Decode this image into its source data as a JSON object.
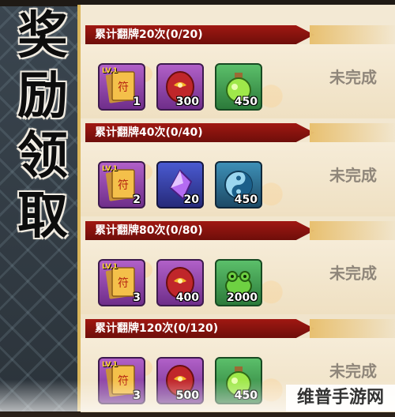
{
  "title_chars": [
    "奖",
    "励",
    "领",
    "取"
  ],
  "rows": [
    {
      "label": "累计翻牌20次(0/20)",
      "status": "未完成",
      "items": [
        {
          "icon": "scroll-card-icon",
          "lv": "LV.1",
          "count": "1"
        },
        {
          "icon": "red-gem-icon",
          "lv": "",
          "count": "300"
        },
        {
          "icon": "green-potion-icon",
          "lv": "",
          "count": "450"
        }
      ]
    },
    {
      "label": "累计翻牌40次(0/40)",
      "status": "未完成",
      "items": [
        {
          "icon": "scroll-card-icon",
          "lv": "LV.1",
          "count": "2"
        },
        {
          "icon": "purple-crystal-icon",
          "lv": "",
          "count": "20"
        },
        {
          "icon": "blue-yin-yang-icon",
          "lv": "",
          "count": "450"
        }
      ]
    },
    {
      "label": "累计翻牌80次(0/80)",
      "status": "未完成",
      "items": [
        {
          "icon": "scroll-card-icon",
          "lv": "LV.1",
          "count": "3"
        },
        {
          "icon": "red-gem-icon",
          "lv": "",
          "count": "400"
        },
        {
          "icon": "green-frog-icon",
          "lv": "",
          "count": "2000"
        }
      ]
    },
    {
      "label": "累计翻牌120次(0/120)",
      "status": "未完成",
      "items": [
        {
          "icon": "scroll-card-icon",
          "lv": "LV.1",
          "count": "3"
        },
        {
          "icon": "red-gem-icon",
          "lv": "",
          "count": "500"
        },
        {
          "icon": "green-potion-icon",
          "lv": "",
          "count": "450"
        }
      ]
    }
  ],
  "watermark": "维普手游网"
}
